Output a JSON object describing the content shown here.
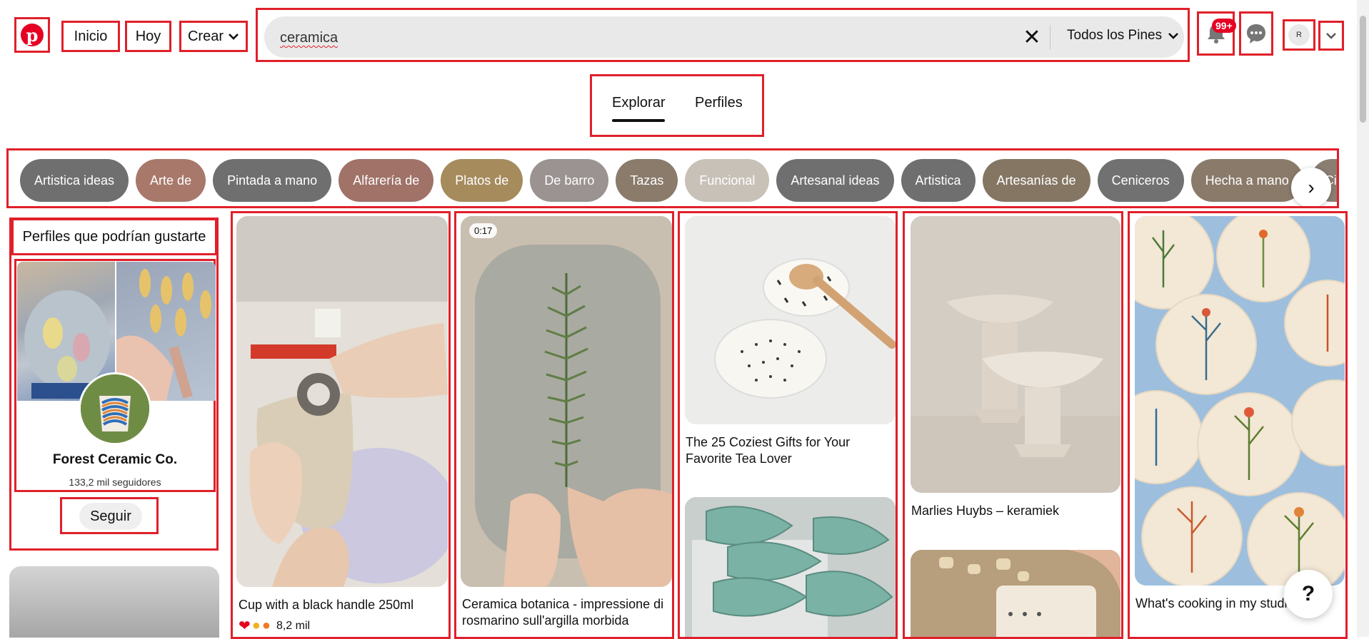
{
  "header": {
    "logo_letter": "p",
    "nav": {
      "home": "Inicio",
      "today": "Hoy",
      "create": "Crear"
    },
    "search": {
      "value": "ceramica",
      "filter_label": "Todos los Pines"
    },
    "notifications_badge": "99+",
    "avatar_initial": "R"
  },
  "tabs": {
    "explore": "Explorar",
    "profiles": "Perfiles"
  },
  "chips": [
    {
      "label": "Artistica ideas",
      "color": "#6f6f6f"
    },
    {
      "label": "Arte de",
      "color": "#a8786a"
    },
    {
      "label": "Pintada a mano",
      "color": "#6f6f6f"
    },
    {
      "label": "Alfarería de",
      "color": "#a07268"
    },
    {
      "label": "Platos de",
      "color": "#a68b5d"
    },
    {
      "label": "De barro",
      "color": "#9a9391"
    },
    {
      "label": "Tazas",
      "color": "#8a7b6b"
    },
    {
      "label": "Funcional",
      "color": "#c8c1b8"
    },
    {
      "label": "Artesanal ideas",
      "color": "#6f6f6f"
    },
    {
      "label": "Artistica",
      "color": "#6f6f6f"
    },
    {
      "label": "Artesanías de",
      "color": "#857664"
    },
    {
      "label": "Ceniceros",
      "color": "#717171"
    },
    {
      "label": "Hecha a mano",
      "color": "#8a7a6a"
    },
    {
      "label": "Cimientos",
      "color": "#8a7d72"
    }
  ],
  "profiles": {
    "title": "Perfiles que podrían gustarte",
    "name": "Forest Ceramic Co.",
    "followers": "133,2  mil seguidores",
    "follow_label": "Seguir"
  },
  "pins": {
    "pin1": {
      "title": "Cup with a black handle 250ml",
      "reactions": "8,2  mil"
    },
    "pin2": {
      "duration": "0:17",
      "title": "Ceramica botanica - impressione di rosmarino sull'argilla morbida"
    },
    "pin3": {
      "title": "The 25 Coziest Gifts for Your Favorite Tea Lover"
    },
    "pin4": {
      "title": "Marlies Huybs – keramiek"
    },
    "pin5": {
      "title": "What's cooking in my studio"
    }
  },
  "help_label": "?"
}
